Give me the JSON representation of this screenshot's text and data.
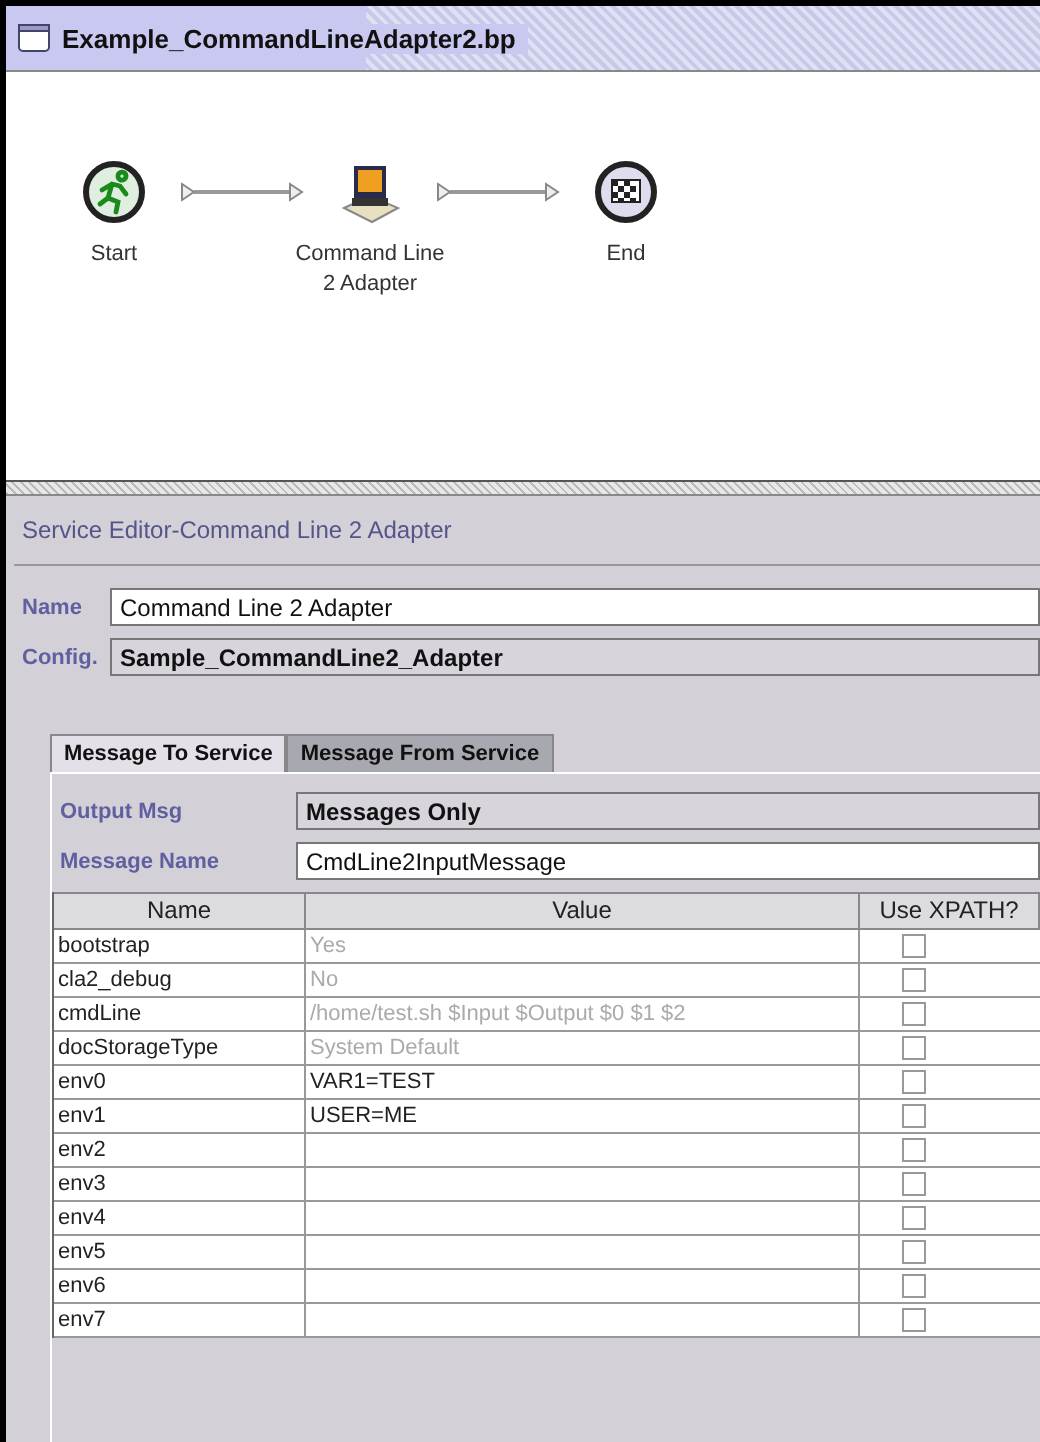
{
  "window": {
    "title": "Example_CommandLineAdapter2.bp"
  },
  "diagram": {
    "nodes": [
      {
        "kind": "start",
        "label": "Start"
      },
      {
        "kind": "adapter",
        "label": "Command Line 2 Adapter"
      },
      {
        "kind": "end",
        "label": "End"
      }
    ]
  },
  "editor": {
    "title": "Service Editor-Command Line 2 Adapter",
    "fields": [
      {
        "label": "Name",
        "value": "Command Line 2 Adapter",
        "kind": "text"
      },
      {
        "label": "Config.",
        "value": "Sample_CommandLine2_Adapter",
        "kind": "select"
      }
    ],
    "tabs": [
      {
        "label": "Message To Service",
        "selected": true
      },
      {
        "label": "Message From Service",
        "selected": false
      }
    ],
    "tab_fields": [
      {
        "label": "Output Msg",
        "value": "Messages Only",
        "kind": "select"
      },
      {
        "label": "Message Name",
        "value": "CmdLine2InputMessage",
        "kind": "text"
      }
    ],
    "table": {
      "columns": [
        "Name",
        "Value",
        "Use XPATH?"
      ],
      "rows": [
        {
          "name": "bootstrap",
          "value": "Yes",
          "readonly": true,
          "checked": false
        },
        {
          "name": "cla2_debug",
          "value": "No",
          "readonly": true,
          "checked": false
        },
        {
          "name": "cmdLine",
          "value": "/home/test.sh $Input $Output $0 $1 $2",
          "readonly": true,
          "checked": false
        },
        {
          "name": "docStorageType",
          "value": "System Default",
          "readonly": true,
          "checked": false
        },
        {
          "name": "env0",
          "value": "VAR1=TEST",
          "readonly": false,
          "checked": false
        },
        {
          "name": "env1",
          "value": "USER=ME",
          "readonly": false,
          "checked": false
        },
        {
          "name": "env2",
          "checked": false
        },
        {
          "name": "env3",
          "checked": false
        },
        {
          "name": "env4",
          "checked": false
        },
        {
          "name": "env5",
          "checked": false
        },
        {
          "name": "env6",
          "checked": false
        },
        {
          "name": "env7",
          "checked": false
        }
      ]
    }
  }
}
